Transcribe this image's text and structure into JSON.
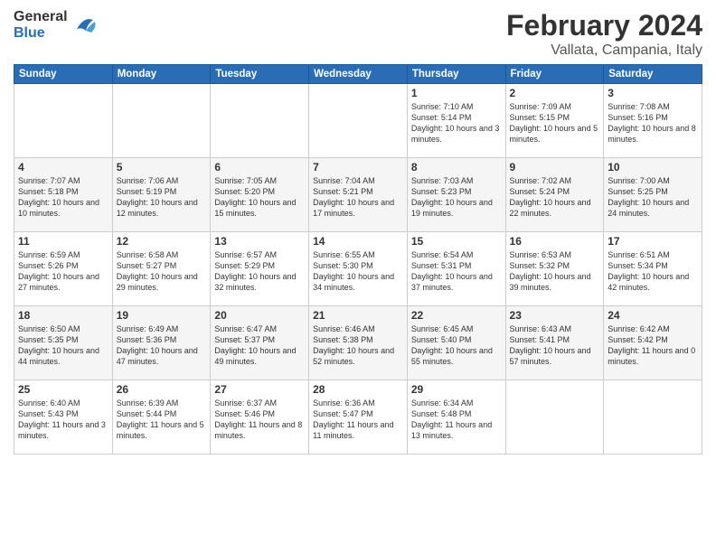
{
  "header": {
    "logo": {
      "general": "General",
      "blue": "Blue"
    },
    "title": "February 2024",
    "subtitle": "Vallata, Campania, Italy"
  },
  "calendar": {
    "days_of_week": [
      "Sunday",
      "Monday",
      "Tuesday",
      "Wednesday",
      "Thursday",
      "Friday",
      "Saturday"
    ],
    "weeks": [
      [
        {
          "day": "",
          "info": ""
        },
        {
          "day": "",
          "info": ""
        },
        {
          "day": "",
          "info": ""
        },
        {
          "day": "",
          "info": ""
        },
        {
          "day": "1",
          "info": "Sunrise: 7:10 AM\nSunset: 5:14 PM\nDaylight: 10 hours\nand 3 minutes."
        },
        {
          "day": "2",
          "info": "Sunrise: 7:09 AM\nSunset: 5:15 PM\nDaylight: 10 hours\nand 5 minutes."
        },
        {
          "day": "3",
          "info": "Sunrise: 7:08 AM\nSunset: 5:16 PM\nDaylight: 10 hours\nand 8 minutes."
        }
      ],
      [
        {
          "day": "4",
          "info": "Sunrise: 7:07 AM\nSunset: 5:18 PM\nDaylight: 10 hours\nand 10 minutes."
        },
        {
          "day": "5",
          "info": "Sunrise: 7:06 AM\nSunset: 5:19 PM\nDaylight: 10 hours\nand 12 minutes."
        },
        {
          "day": "6",
          "info": "Sunrise: 7:05 AM\nSunset: 5:20 PM\nDaylight: 10 hours\nand 15 minutes."
        },
        {
          "day": "7",
          "info": "Sunrise: 7:04 AM\nSunset: 5:21 PM\nDaylight: 10 hours\nand 17 minutes."
        },
        {
          "day": "8",
          "info": "Sunrise: 7:03 AM\nSunset: 5:23 PM\nDaylight: 10 hours\nand 19 minutes."
        },
        {
          "day": "9",
          "info": "Sunrise: 7:02 AM\nSunset: 5:24 PM\nDaylight: 10 hours\nand 22 minutes."
        },
        {
          "day": "10",
          "info": "Sunrise: 7:00 AM\nSunset: 5:25 PM\nDaylight: 10 hours\nand 24 minutes."
        }
      ],
      [
        {
          "day": "11",
          "info": "Sunrise: 6:59 AM\nSunset: 5:26 PM\nDaylight: 10 hours\nand 27 minutes."
        },
        {
          "day": "12",
          "info": "Sunrise: 6:58 AM\nSunset: 5:27 PM\nDaylight: 10 hours\nand 29 minutes."
        },
        {
          "day": "13",
          "info": "Sunrise: 6:57 AM\nSunset: 5:29 PM\nDaylight: 10 hours\nand 32 minutes."
        },
        {
          "day": "14",
          "info": "Sunrise: 6:55 AM\nSunset: 5:30 PM\nDaylight: 10 hours\nand 34 minutes."
        },
        {
          "day": "15",
          "info": "Sunrise: 6:54 AM\nSunset: 5:31 PM\nDaylight: 10 hours\nand 37 minutes."
        },
        {
          "day": "16",
          "info": "Sunrise: 6:53 AM\nSunset: 5:32 PM\nDaylight: 10 hours\nand 39 minutes."
        },
        {
          "day": "17",
          "info": "Sunrise: 6:51 AM\nSunset: 5:34 PM\nDaylight: 10 hours\nand 42 minutes."
        }
      ],
      [
        {
          "day": "18",
          "info": "Sunrise: 6:50 AM\nSunset: 5:35 PM\nDaylight: 10 hours\nand 44 minutes."
        },
        {
          "day": "19",
          "info": "Sunrise: 6:49 AM\nSunset: 5:36 PM\nDaylight: 10 hours\nand 47 minutes."
        },
        {
          "day": "20",
          "info": "Sunrise: 6:47 AM\nSunset: 5:37 PM\nDaylight: 10 hours\nand 49 minutes."
        },
        {
          "day": "21",
          "info": "Sunrise: 6:46 AM\nSunset: 5:38 PM\nDaylight: 10 hours\nand 52 minutes."
        },
        {
          "day": "22",
          "info": "Sunrise: 6:45 AM\nSunset: 5:40 PM\nDaylight: 10 hours\nand 55 minutes."
        },
        {
          "day": "23",
          "info": "Sunrise: 6:43 AM\nSunset: 5:41 PM\nDaylight: 10 hours\nand 57 minutes."
        },
        {
          "day": "24",
          "info": "Sunrise: 6:42 AM\nSunset: 5:42 PM\nDaylight: 11 hours\nand 0 minutes."
        }
      ],
      [
        {
          "day": "25",
          "info": "Sunrise: 6:40 AM\nSunset: 5:43 PM\nDaylight: 11 hours\nand 3 minutes."
        },
        {
          "day": "26",
          "info": "Sunrise: 6:39 AM\nSunset: 5:44 PM\nDaylight: 11 hours\nand 5 minutes."
        },
        {
          "day": "27",
          "info": "Sunrise: 6:37 AM\nSunset: 5:46 PM\nDaylight: 11 hours\nand 8 minutes."
        },
        {
          "day": "28",
          "info": "Sunrise: 6:36 AM\nSunset: 5:47 PM\nDaylight: 11 hours\nand 11 minutes."
        },
        {
          "day": "29",
          "info": "Sunrise: 6:34 AM\nSunset: 5:48 PM\nDaylight: 11 hours\nand 13 minutes."
        },
        {
          "day": "",
          "info": ""
        },
        {
          "day": "",
          "info": ""
        }
      ]
    ]
  }
}
